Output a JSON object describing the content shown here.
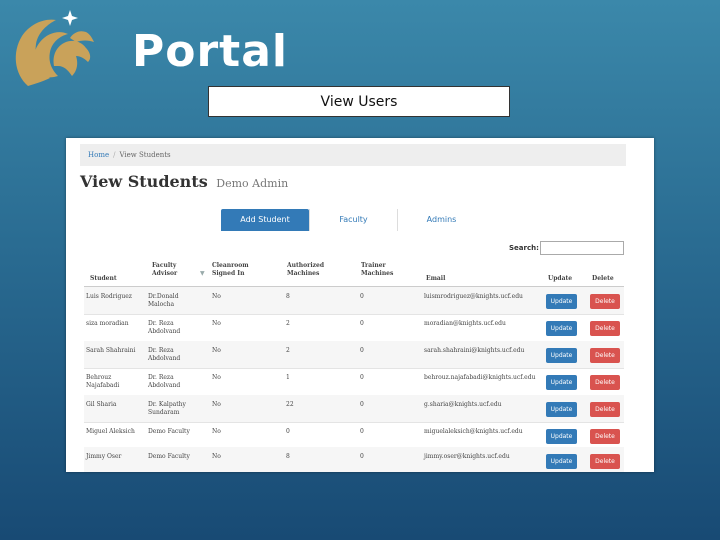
{
  "header": {
    "portal_title": "Portal",
    "view_users_label": "View Users"
  },
  "colors": {
    "logo_gold": "#c9a25a",
    "primary_blue": "#337ab7",
    "delete_red": "#d9534f"
  },
  "app": {
    "breadcrumb": {
      "home": "Home",
      "current": "View Students"
    },
    "page_title": "View Students",
    "page_subtitle": "Demo Admin",
    "tabs": [
      {
        "label": "Add Student",
        "active": true
      },
      {
        "label": "Faculty",
        "active": false
      },
      {
        "label": "Admins",
        "active": false
      }
    ],
    "search_label": "Search:",
    "search_value": "",
    "columns": [
      "Student",
      "Faculty Advisor",
      "Cleanroom Signed In",
      "Authorized Machines",
      "Trainer Machines",
      "Email",
      "Update",
      "Delete"
    ],
    "rows": [
      {
        "student": "Luis Rodriguez",
        "advisor": "Dr.Donald Malocha",
        "cleanroom": "No",
        "authorized": "8",
        "trainer": "0",
        "email": "luismrodriguez@knights.ucf.edu"
      },
      {
        "student": "siza moradian",
        "advisor": "Dr. Reza Abdolvand",
        "cleanroom": "No",
        "authorized": "2",
        "trainer": "0",
        "email": "moradian@knights.ucf.edu"
      },
      {
        "student": "Sarah Shahraini",
        "advisor": "Dr. Reza Abdolvand",
        "cleanroom": "No",
        "authorized": "2",
        "trainer": "0",
        "email": "sarah.shahraini@knights.ucf.edu"
      },
      {
        "student": "Behrouz Najafabadi",
        "advisor": "Dr. Reza Abdolvand",
        "cleanroom": "No",
        "authorized": "1",
        "trainer": "0",
        "email": "behrouz.najafabadi@knights.ucf.edu"
      },
      {
        "student": "Gil Sharia",
        "advisor": "Dr. Kalpathy Sundaram",
        "cleanroom": "No",
        "authorized": "22",
        "trainer": "0",
        "email": "g.sharia@knights.ucf.edu"
      },
      {
        "student": "Miguel Aleksich",
        "advisor": "Demo Faculty",
        "cleanroom": "No",
        "authorized": "0",
        "trainer": "0",
        "email": "miguelaleksich@knights.ucf.edu"
      },
      {
        "student": "Jimmy Oser",
        "advisor": "Demo Faculty",
        "cleanroom": "No",
        "authorized": "8",
        "trainer": "0",
        "email": "jimmy.oser@knights.ucf.edu"
      }
    ],
    "update_label": "Update",
    "delete_label": "Delete"
  }
}
